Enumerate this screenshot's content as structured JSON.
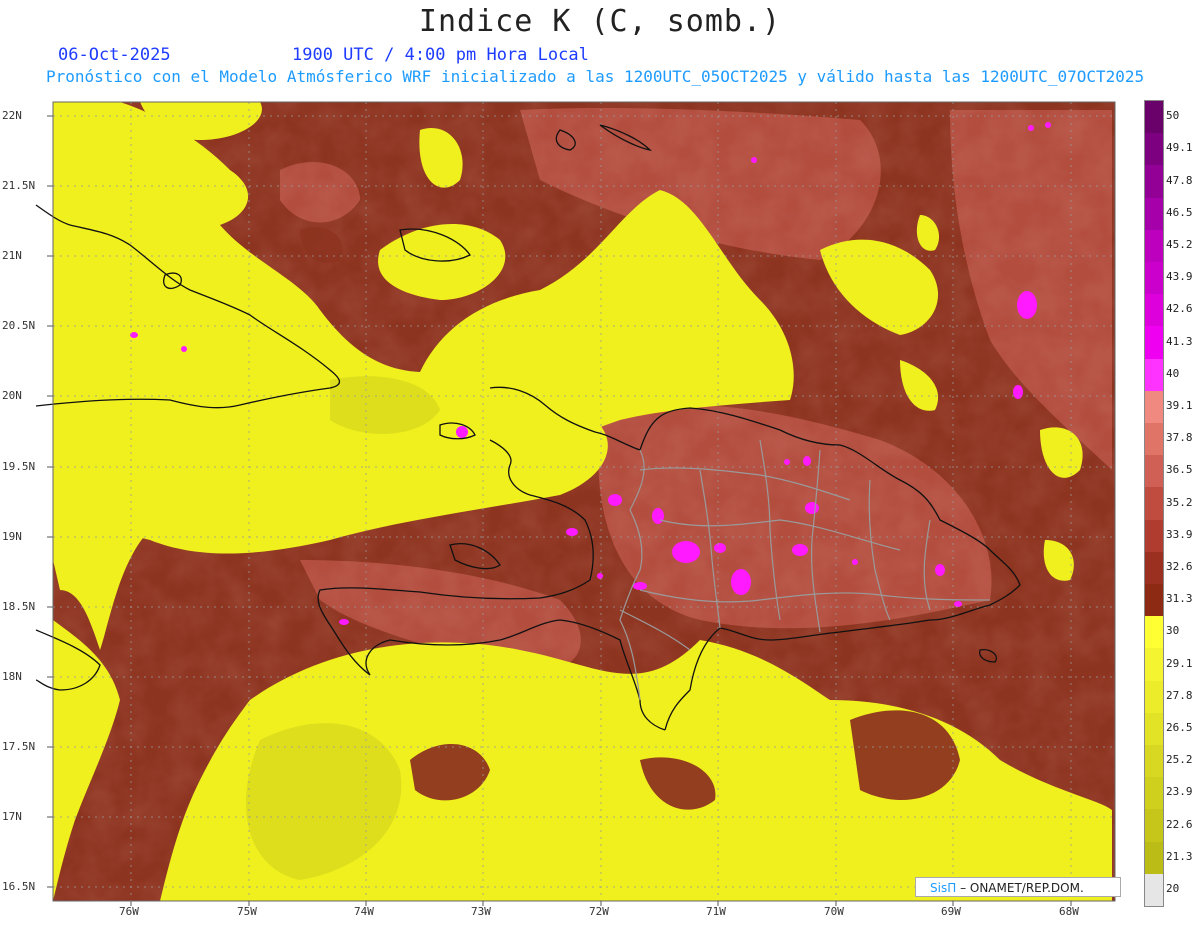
{
  "title": "Indice K (C, somb.)",
  "date": "06-Oct-2025",
  "time": "1900 UTC / 4:00 pm Hora Local",
  "description": "Pronóstico con el Modelo Atmósferico WRF inicializado a las 1200UTC_05OCT2025 y válido hasta las  1200UTC_07OCT2025",
  "credit": {
    "brand": "SisΠ",
    "org": "– ONAMET/REP.DOM."
  },
  "lat_labels": [
    "22N",
    "21.5N",
    "21N",
    "20.5N",
    "20N",
    "19.5N",
    "19N",
    "18.5N",
    "18N",
    "17.5N",
    "17N",
    "16.5N"
  ],
  "lon_labels": [
    "76W",
    "75W",
    "74W",
    "73W",
    "72W",
    "71W",
    "70W",
    "69W",
    "68W"
  ],
  "legend": {
    "labels": [
      "50",
      "49.1",
      "47.8",
      "46.5",
      "45.2",
      "43.9",
      "42.6",
      "41.3",
      "40",
      "39.1",
      "37.8",
      "36.5",
      "35.2",
      "33.9",
      "32.6",
      "31.3",
      "30",
      "29.1",
      "27.8",
      "26.5",
      "25.2",
      "23.9",
      "22.6",
      "21.3",
      "20"
    ],
    "colors": [
      "#6a006a",
      "#7d0080",
      "#930096",
      "#a600aa",
      "#bc00be",
      "#cc00cc",
      "#dd00dd",
      "#f000f0",
      "#ff33ff",
      "#f08a80",
      "#e07466",
      "#d06055",
      "#c04c40",
      "#b03c30",
      "#9c3020",
      "#8c2a14",
      "#ffff33",
      "#f4f430",
      "#ecec2a",
      "#e2e226",
      "#d8d822",
      "#cfcf1e",
      "#c6c61a",
      "#bcbc16",
      "#e6e6e6"
    ]
  }
}
